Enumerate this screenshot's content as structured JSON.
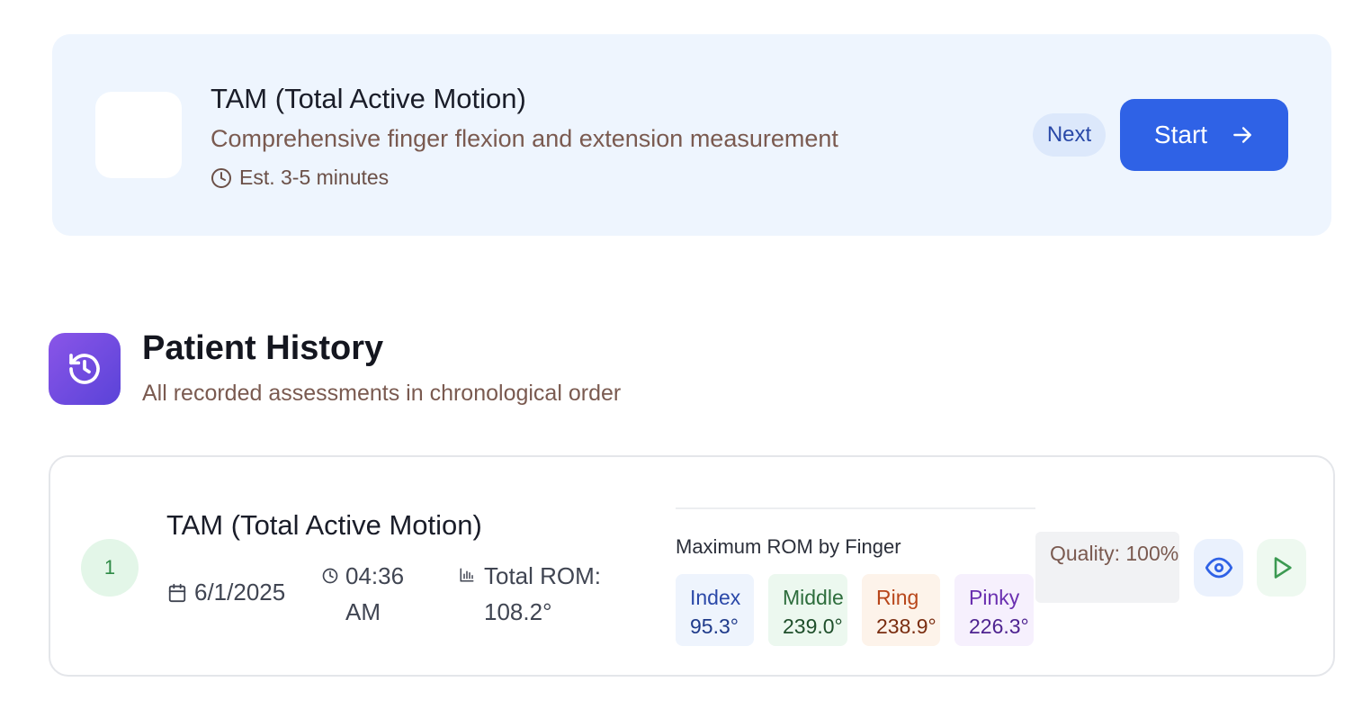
{
  "assessment": {
    "title": "TAM (Total Active Motion)",
    "description": "Comprehensive finger flexion and extension measurement",
    "estimate": "Est. 3-5 minutes",
    "next_badge": "Next",
    "start_label": "Start"
  },
  "history": {
    "title": "Patient History",
    "subtitle": "All recorded assessments in chronological order",
    "records": [
      {
        "index": "1",
        "title": "TAM (Total Active Motion)",
        "date": "6/1/2025",
        "time": "04:36 AM",
        "total_rom": "Total ROM: 108.2°",
        "rom_heading": "Maximum ROM by Finger",
        "fingers": [
          {
            "name": "Index",
            "value": "95.3°"
          },
          {
            "name": "Middle",
            "value": "239.0°"
          },
          {
            "name": "Ring",
            "value": "238.9°"
          },
          {
            "name": "Pinky",
            "value": "226.3°"
          }
        ],
        "quality": "Quality: 100%"
      }
    ]
  },
  "colors": {
    "accent": "#2f62e6",
    "card_bg": "#eef5fe",
    "history_icon": "#6b4ae0",
    "status_green": "#2f8a46"
  },
  "icons": {
    "estimate": "clock-icon",
    "start": "arrow-right-icon",
    "history": "history-icon",
    "date": "calendar-icon",
    "time": "clock-icon",
    "rom": "bar-chart-icon",
    "view": "eye-icon",
    "replay": "play-icon"
  }
}
